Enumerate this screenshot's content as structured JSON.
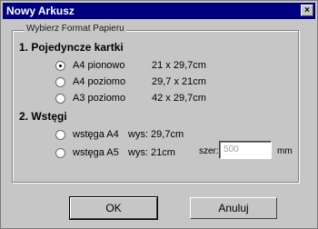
{
  "window": {
    "title": "Nowy Arkusz",
    "close_label": "×"
  },
  "group": {
    "legend": "Wybierz Format Papieru"
  },
  "section1": {
    "heading": "1. Pojedyncze kartki",
    "options": [
      {
        "label": "A4 pionowo",
        "size": "21 x 29,7cm",
        "checked": true
      },
      {
        "label": "A4 poziomo",
        "size": "29,7 x 21cm",
        "checked": false
      },
      {
        "label": "A3 poziomo",
        "size": "42 x 29,7cm",
        "checked": false
      }
    ]
  },
  "section2": {
    "heading": "2. Wstęgi",
    "options": [
      {
        "label": "wstęga A4",
        "height": "wys: 29,7cm",
        "checked": false
      },
      {
        "label": "wstęga A5",
        "height": "wys: 21cm",
        "checked": false
      }
    ],
    "width_label": "szer:",
    "width_value": "500",
    "width_unit": "mm"
  },
  "buttons": {
    "ok": "OK",
    "cancel": "Anuluj"
  }
}
